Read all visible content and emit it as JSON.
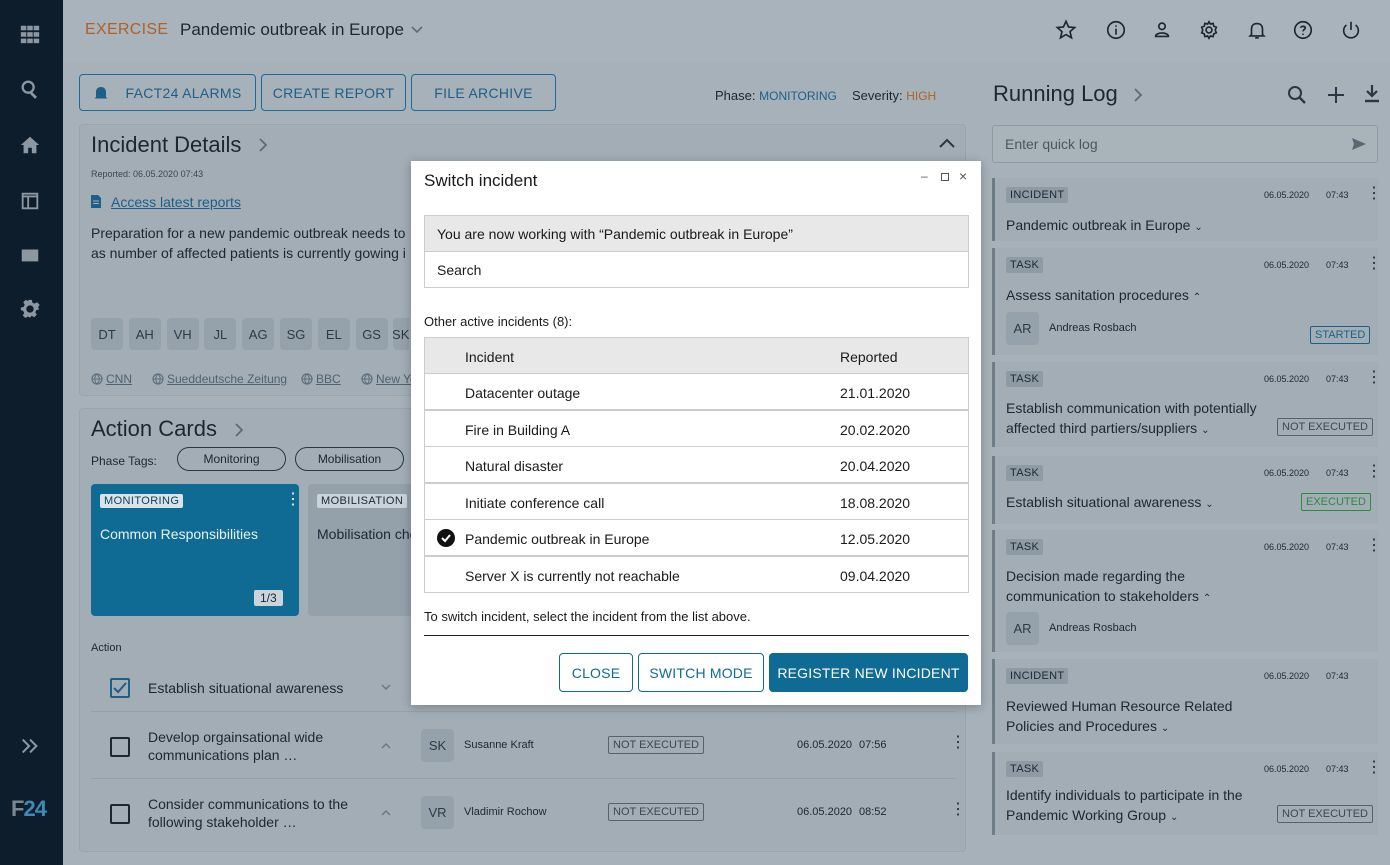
{
  "header": {
    "exercise_label": "EXERCISE",
    "incident_title": "Pandemic outbreak in Europe"
  },
  "toolbar": {
    "alarms_label": "FACT24 ALARMS",
    "create_report_label": "CREATE REPORT",
    "file_archive_label": "FILE ARCHIVE",
    "phase_label": "Phase:",
    "phase_value": "MONITORING",
    "severity_label": "Severity:",
    "severity_value": "HIGH"
  },
  "incident_details": {
    "title": "Incident Details",
    "reported": "Reported: 06.05.2020 07:43",
    "reports_link": "Access latest reports",
    "description_line1": "Preparation for a new pandemic outbreak needs to",
    "description_line2": "as number of affected patients is currently gowing i",
    "chips": [
      "DT",
      "AH",
      "VH",
      "JL",
      "AG",
      "SG",
      "EL",
      "GS",
      "SK"
    ],
    "sources": [
      "CNN",
      "Sueddeutsche Zeitung",
      "BBC",
      "New Yo"
    ]
  },
  "action_cards": {
    "title": "Action Cards",
    "phase_tags_label": "Phase Tags:",
    "phase_tags": [
      "Monitoring",
      "Mobilisation"
    ],
    "card1": {
      "tag": "MONITORING",
      "title": "Common Responsibilities",
      "pager": "1/3"
    },
    "card2": {
      "tag": "MOBILISATION",
      "title": "Mobilisation che"
    },
    "action_header": "Action",
    "actions": [
      {
        "title": "Establish situational awareness",
        "checked": true
      },
      {
        "title_line1": "Develop orgainsational wide",
        "title_line2": "communications plan …",
        "initials": "SK",
        "assignee": "Susanne Kraft",
        "status": "NOT EXECUTED",
        "date": "06.05.2020",
        "time": "07:56"
      },
      {
        "title_line1": "Consider communications to the",
        "title_line2": "following stakeholder …",
        "initials": "VR",
        "assignee": "Vladimir Rochow",
        "status": "NOT EXECUTED",
        "date": "06.05.2020",
        "time": "08:52"
      }
    ]
  },
  "running_log": {
    "title": "Running Log",
    "quick_log_placeholder": "Enter quick log",
    "entries": [
      {
        "type": "INCIDENT",
        "date": "06.05.2020",
        "time": "07:43",
        "title": "Pandemic outbreak in Europe"
      },
      {
        "type": "TASK",
        "date": "06.05.2020",
        "time": "07:43",
        "title": "Assess sanitation procedures",
        "initials": "AR",
        "assignee": "Andreas Rosbach",
        "status": "STARTED"
      },
      {
        "type": "TASK",
        "date": "06.05.2020",
        "time": "07:43",
        "title_line1": "Establish communication with potentially",
        "title_line2": "affected third partiers/suppliers",
        "status": "NOT EXECUTED"
      },
      {
        "type": "TASK",
        "date": "06.05.2020",
        "time": "07:43",
        "title": "Establish situational awareness",
        "status": "EXECUTED"
      },
      {
        "type": "TASK",
        "date": "06.05.2020",
        "time": "07:43",
        "title_line1": "Decision made regarding the",
        "title_line2": "communication to stakeholders",
        "initials": "AR",
        "assignee": "Andreas Rosbach"
      },
      {
        "type": "INCIDENT",
        "date": "06.05.2020",
        "time": "07:43",
        "title_line1": "Reviewed Human Resource Related",
        "title_line2": "Policies and Procedures"
      },
      {
        "type": "TASK",
        "date": "06.05.2020",
        "time": "07:43",
        "title_line1": "Identify individuals to participate in the",
        "title_line2": "Pandemic Working Group",
        "status": "NOT EXECUTED"
      }
    ]
  },
  "modal": {
    "title": "Switch incident",
    "current_text": "You are now working with “Pandemic outbreak in Europe”",
    "search_placeholder": "Search",
    "other_label": "Other active incidents (8):",
    "col_incident": "Incident",
    "col_reported": "Reported",
    "rows": [
      {
        "name": "Datacenter outage",
        "date": "21.01.2020",
        "selected": false
      },
      {
        "name": "Fire in Building A",
        "date": "20.02.2020",
        "selected": false
      },
      {
        "name": "Natural disaster",
        "date": "20.04.2020",
        "selected": false
      },
      {
        "name": "Initiate conference call",
        "date": "18.08.2020",
        "selected": false
      },
      {
        "name": "Pandemic outbreak in Europe",
        "date": "12.05.2020",
        "selected": true
      },
      {
        "name": "Server X is currently not reachable",
        "date": "09.04.2020",
        "selected": false
      }
    ],
    "hint": "To switch incident, select the incident from the list above.",
    "close_label": "CLOSE",
    "switch_mode_label": "SWITCH MODE",
    "register_label": "REGISTER NEW INCIDENT"
  },
  "rail": {
    "logo_f": "F",
    "logo_num": "24"
  },
  "colors": {
    "rail": "#0d1d2c",
    "accent": "#0f6b94",
    "card_active": "#0f6b94",
    "severity": "#b0602a",
    "executed": "#2e8a3e"
  }
}
